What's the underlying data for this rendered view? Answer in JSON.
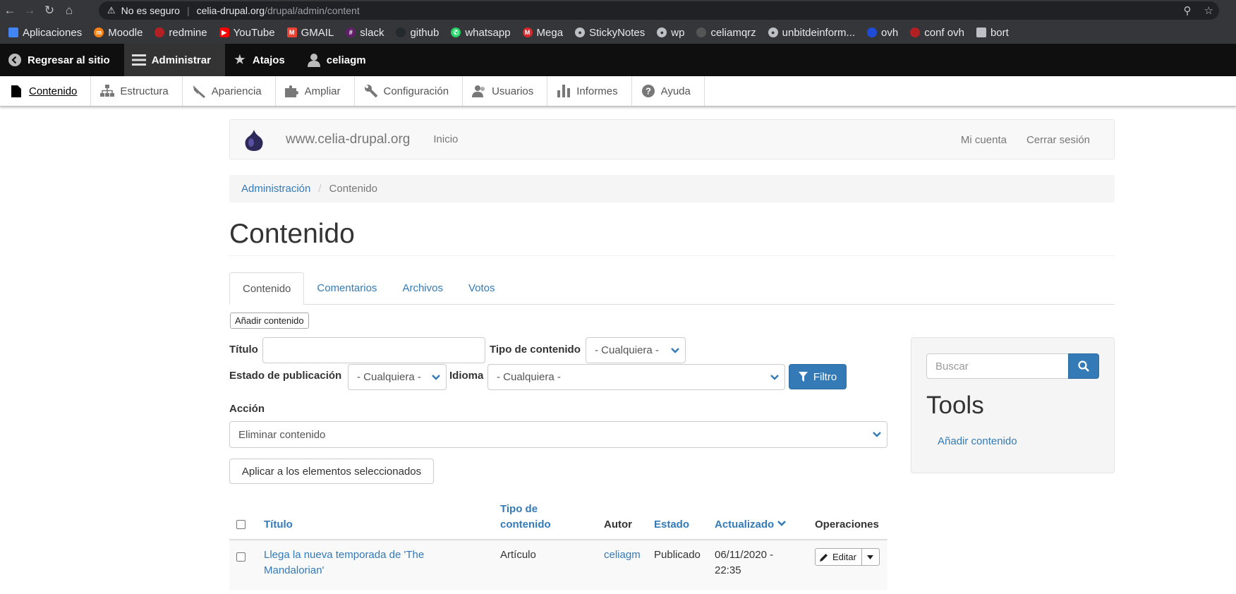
{
  "browser": {
    "security_label": "No es seguro",
    "url_host": "celia-drupal.org",
    "url_path": "/drupal/admin/content",
    "bookmarks": [
      "Aplicaciones",
      "Moodle",
      "redmine",
      "YouTube",
      "GMAIL",
      "slack",
      "github",
      "whatsapp",
      "Mega",
      "StickyNotes",
      "wp",
      "celiamqrz",
      "unbitdeinform...",
      "ovh",
      "conf ovh",
      "bort"
    ]
  },
  "toolbar": {
    "back_to_site": "Regresar al sitio",
    "manage": "Administrar",
    "shortcuts": "Atajos",
    "user": "celiagm"
  },
  "tray": {
    "items": [
      "Contenido",
      "Estructura",
      "Apariencia",
      "Ampliar",
      "Configuración",
      "Usuarios",
      "Informes",
      "Ayuda"
    ]
  },
  "site": {
    "name": "www.celia-drupal.org",
    "home": "Inicio",
    "my_account": "Mi cuenta",
    "logout": "Cerrar sesión"
  },
  "breadcrumb": {
    "parent": "Administración",
    "current": "Contenido"
  },
  "page": {
    "title": "Contenido"
  },
  "tabs": [
    "Contenido",
    "Comentarios",
    "Archivos",
    "Votos"
  ],
  "add_content_button": "Añadir contenido",
  "filters": {
    "title_label": "Título",
    "title_value": "",
    "type_label": "Tipo de contenido",
    "type_value": "- Cualquiera -",
    "status_label": "Estado de publicación",
    "status_value": "- Cualquiera -",
    "language_label": "Idioma",
    "language_value": "- Cualquiera -",
    "filter_button": "Filtro"
  },
  "action": {
    "label": "Acción",
    "value": "Eliminar contenido",
    "apply_button": "Aplicar a los elementos seleccionados"
  },
  "sidebar": {
    "search_placeholder": "Buscar",
    "tools_title": "Tools",
    "tools_link": "Añadir contenido"
  },
  "table": {
    "headers": {
      "title": "Título",
      "type_line1": "Tipo de",
      "type_line2": "contenido",
      "author": "Autor",
      "status": "Estado",
      "updated": "Actualizado",
      "operations": "Operaciones"
    },
    "rows": [
      {
        "title_line1": "Llega la nueva temporada de 'The",
        "title_line2": "Mandalorian'",
        "type": "Artículo",
        "author": "celiagm",
        "status": "Publicado",
        "updated_line1": "06/11/2020 -",
        "updated_line2": "22:35",
        "edit_label": "Editar"
      }
    ]
  },
  "colors": {
    "link": "#337ab7",
    "toolbar_bg": "#0f0f0f",
    "primary_button": "#337ab7"
  }
}
